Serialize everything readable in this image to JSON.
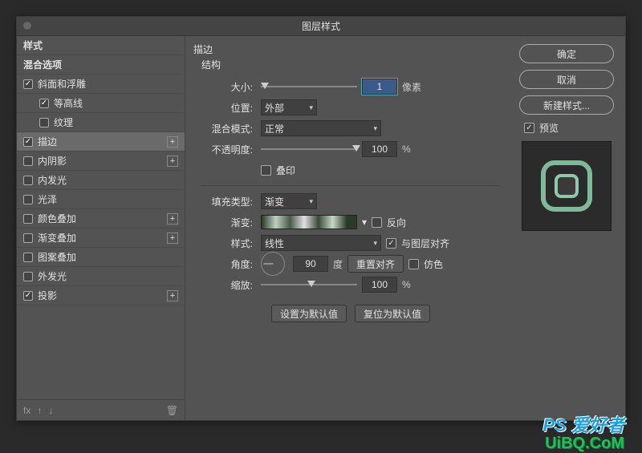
{
  "dialog": {
    "title": "图层样式"
  },
  "left": {
    "headers": [
      "样式",
      "混合选项"
    ],
    "items": [
      {
        "label": "斜面和浮雕",
        "checked": true,
        "plus": false,
        "sub": false
      },
      {
        "label": "等高线",
        "checked": true,
        "plus": false,
        "sub": true
      },
      {
        "label": "纹理",
        "checked": false,
        "plus": false,
        "sub": true
      },
      {
        "label": "描边",
        "checked": true,
        "plus": true,
        "sub": false,
        "selected": true
      },
      {
        "label": "内阴影",
        "checked": false,
        "plus": true,
        "sub": false
      },
      {
        "label": "内发光",
        "checked": false,
        "plus": false,
        "sub": false
      },
      {
        "label": "光泽",
        "checked": false,
        "plus": false,
        "sub": false
      },
      {
        "label": "颜色叠加",
        "checked": false,
        "plus": true,
        "sub": false
      },
      {
        "label": "渐变叠加",
        "checked": false,
        "plus": true,
        "sub": false
      },
      {
        "label": "图案叠加",
        "checked": false,
        "plus": false,
        "sub": false
      },
      {
        "label": "外发光",
        "checked": false,
        "plus": false,
        "sub": false
      },
      {
        "label": "投影",
        "checked": true,
        "plus": true,
        "sub": false
      }
    ],
    "footer": {
      "fx": "fx",
      "up": "↑",
      "down": "↓",
      "trash": "🗑"
    }
  },
  "stroke": {
    "section": "描边",
    "sub": "结构",
    "size_label": "大小:",
    "size_value": "1",
    "size_unit": "像素",
    "position_label": "位置:",
    "position_value": "外部",
    "blend_label": "混合模式:",
    "blend_value": "正常",
    "opacity_label": "不透明度:",
    "opacity_value": "100",
    "opacity_unit": "%",
    "overprint_label": "叠印",
    "fill_label": "填充类型:",
    "fill_value": "渐变",
    "gradient_label": "渐变:",
    "reverse_label": "反向",
    "style_label": "样式:",
    "style_value": "线性",
    "align_label": "与图层对齐",
    "angle_label": "角度:",
    "angle_value": "90",
    "angle_unit": "度",
    "reset_align": "重置对齐",
    "dither_label": "仿色",
    "scale_label": "缩放:",
    "scale_value": "100",
    "scale_unit": "%",
    "defaults_set": "设置为默认值",
    "defaults_reset": "复位为默认值"
  },
  "right": {
    "ok": "确定",
    "cancel": "取消",
    "new_style": "新建样式...",
    "preview": "预览"
  },
  "watermark": {
    "line1": "PS 爱好者",
    "line2": "UiBQ.CoM"
  }
}
